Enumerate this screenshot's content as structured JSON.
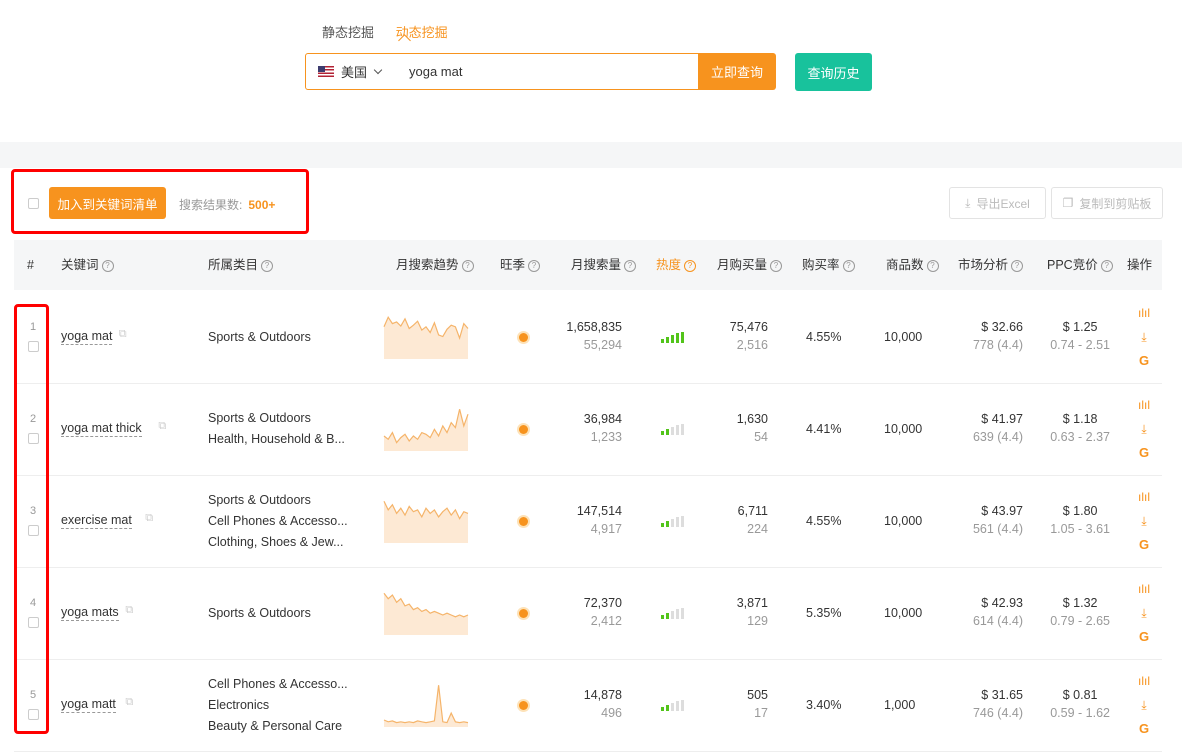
{
  "modes": {
    "static": "静态挖掘",
    "dynamic": "动态挖掘"
  },
  "search": {
    "country": "美国",
    "query": "yoga mat",
    "search_button": "立即查询",
    "history_button": "查询历史"
  },
  "toolbar": {
    "add_button": "加入到关键词清单",
    "result_label": "搜索结果数:",
    "result_count": "500+",
    "export_button": "导出Excel",
    "copy_button": "复制到剪贴板"
  },
  "columns": {
    "index": "#",
    "keyword": "关键词",
    "category": "所属类目",
    "trend": "月搜索趋势",
    "season": "旺季",
    "search_volume": "月搜索量",
    "hotness": "热度",
    "purchases": "月购买量",
    "purchase_rate": "购买率",
    "products": "商品数",
    "market": "市场分析",
    "ppc": "PPC竞价",
    "actions": "操作"
  },
  "colors": {
    "accent": "#f7931e",
    "green": "#18c29c",
    "highlight": "#ff0000"
  },
  "rows": [
    {
      "index": "1",
      "keyword": "yoga mat",
      "categories": [
        "Sports & Outdoors"
      ],
      "trend": [
        40,
        52,
        44,
        46,
        41,
        50,
        38,
        42,
        47,
        36,
        40,
        33,
        45,
        30,
        28,
        37,
        42,
        40,
        26,
        44,
        38
      ],
      "search_volume": "1,658,835",
      "search_sub": "55,294",
      "hot": 5,
      "purchases": "75,476",
      "purchases_sub": "2,516",
      "rate": "4.55%",
      "products": "10,000",
      "price": "$ 32.66",
      "reviews": "778 (4.4)",
      "ppc": "$ 1.25",
      "ppc_range": "0.74 - 2.51"
    },
    {
      "index": "2",
      "keyword": "yoga mat thick",
      "categories": [
        "Sports & Outdoors",
        "Health, Household & B..."
      ],
      "trend": [
        18,
        14,
        22,
        10,
        16,
        20,
        12,
        18,
        14,
        22,
        20,
        16,
        26,
        18,
        30,
        22,
        34,
        28,
        50,
        30,
        44
      ],
      "search_volume": "36,984",
      "search_sub": "1,233",
      "hot": 2,
      "purchases": "1,630",
      "purchases_sub": "54",
      "rate": "4.41%",
      "products": "10,000",
      "price": "$ 41.97",
      "reviews": "639 (4.4)",
      "ppc": "$ 1.18",
      "ppc_range": "0.63 - 2.37"
    },
    {
      "index": "3",
      "keyword": "exercise mat",
      "categories": [
        "Sports & Outdoors",
        "Cell Phones & Accesso...",
        "Clothing, Shoes & Jew..."
      ],
      "trend": [
        48,
        38,
        44,
        34,
        40,
        32,
        42,
        36,
        38,
        30,
        40,
        34,
        38,
        30,
        36,
        40,
        32,
        38,
        28,
        36,
        34
      ],
      "search_volume": "147,514",
      "search_sub": "4,917",
      "hot": 2,
      "purchases": "6,711",
      "purchases_sub": "224",
      "rate": "4.55%",
      "products": "10,000",
      "price": "$ 43.97",
      "reviews": "561 (4.4)",
      "ppc": "$ 1.80",
      "ppc_range": "1.05 - 3.61"
    },
    {
      "index": "4",
      "keyword": "yoga mats",
      "categories": [
        "Sports & Outdoors"
      ],
      "trend": [
        46,
        40,
        44,
        36,
        40,
        32,
        34,
        28,
        30,
        26,
        28,
        24,
        26,
        24,
        22,
        24,
        22,
        20,
        22,
        20,
        22
      ],
      "search_volume": "72,370",
      "search_sub": "2,412",
      "hot": 2,
      "purchases": "3,871",
      "purchases_sub": "129",
      "rate": "5.35%",
      "products": "10,000",
      "price": "$ 42.93",
      "reviews": "614 (4.4)",
      "ppc": "$ 1.32",
      "ppc_range": "0.79 - 2.65"
    },
    {
      "index": "5",
      "keyword": "yoga matt",
      "categories": [
        "Cell Phones & Accesso...",
        "Electronics",
        "Beauty & Personal Care"
      ],
      "trend": [
        8,
        6,
        7,
        5,
        6,
        5,
        6,
        5,
        7,
        6,
        5,
        6,
        7,
        48,
        6,
        5,
        16,
        6,
        5,
        6,
        5
      ],
      "search_volume": "14,878",
      "search_sub": "496",
      "hot": 2,
      "purchases": "505",
      "purchases_sub": "17",
      "rate": "3.40%",
      "products": "1,000",
      "price": "$ 31.65",
      "reviews": "746 (4.4)",
      "ppc": "$ 0.81",
      "ppc_range": "0.59 - 1.62"
    }
  ]
}
